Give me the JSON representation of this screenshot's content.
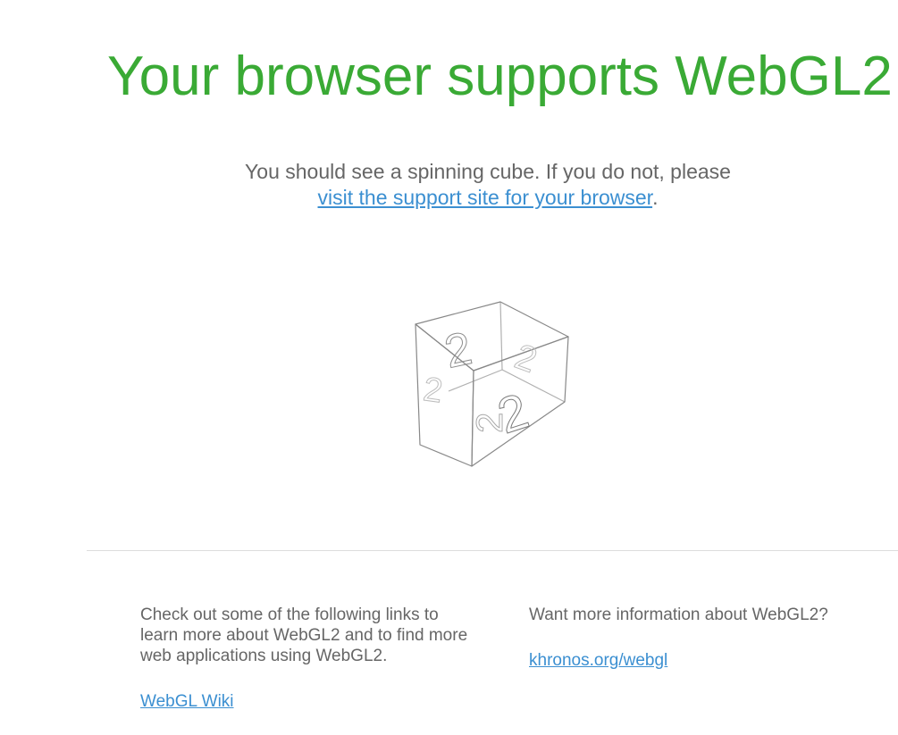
{
  "headline": "Your browser supports WebGL2",
  "intro": {
    "text": "You should see a spinning cube. If you do not, please",
    "link_label": "visit the support site for your browser",
    "trailing": "."
  },
  "cube": {
    "glyph": "2",
    "stroke_color": "#888888"
  },
  "left_column": {
    "text": "Check out some of the following links to learn more about WebGL2 and to find more web applications using WebGL2.",
    "link_label": "WebGL Wiki"
  },
  "right_column": {
    "text": "Want more information about WebGL2?",
    "link_label": "khronos.org/webgl"
  },
  "colors": {
    "headline": "#3aaa35",
    "link": "#3b8fd1",
    "body_text": "#666666"
  }
}
